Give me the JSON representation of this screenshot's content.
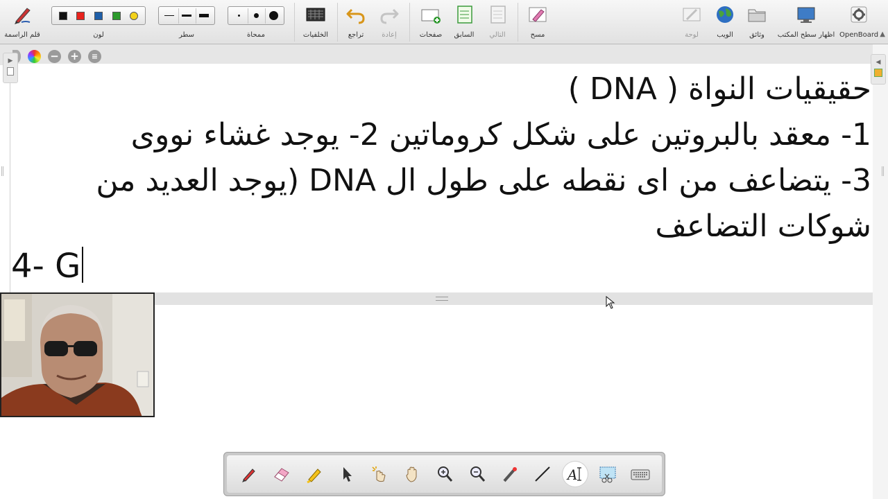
{
  "toolbar": {
    "groups": {
      "pen": "قلم الراسمة",
      "color": "لون",
      "line": "سطر",
      "eraser": "ممحاة",
      "backgrounds": "الخلفيات",
      "undo": "تراجع",
      "redo": "إعادة",
      "pages": "صفحات",
      "previous": "السابق",
      "next": "التالي",
      "clear": "مسح",
      "board": "لوحة",
      "web": "الويب",
      "documents": "وثائق",
      "desktop": "اظهار سطح المكتب",
      "openboard": "OpenBoard"
    },
    "colors": [
      "#111111",
      "#e8231d",
      "#1f5fa8",
      "#2c9a2c",
      "#f3d21b"
    ]
  },
  "document": {
    "lines": [
      "حقيقيات النواة (   DNA )",
      "1- معقد بالبروتين على شكل كروماتين 2- يوجد غشاء نووى",
      "3- يتضاعف من اى نقطه على طول ال DNA (يوجد العديد من",
      "شوكات التضاعف"
    ],
    "typing_line": "4- G"
  },
  "palette": {
    "tools": [
      "pen-tool",
      "eraser-tool",
      "marker-tool",
      "select-tool",
      "interact-tool",
      "hand-tool",
      "zoom-in-tool",
      "zoom-out-tool",
      "laser-tool",
      "line-tool",
      "text-tool",
      "capture-tool",
      "keyboard-tool"
    ],
    "active_tool": "text-tool"
  }
}
